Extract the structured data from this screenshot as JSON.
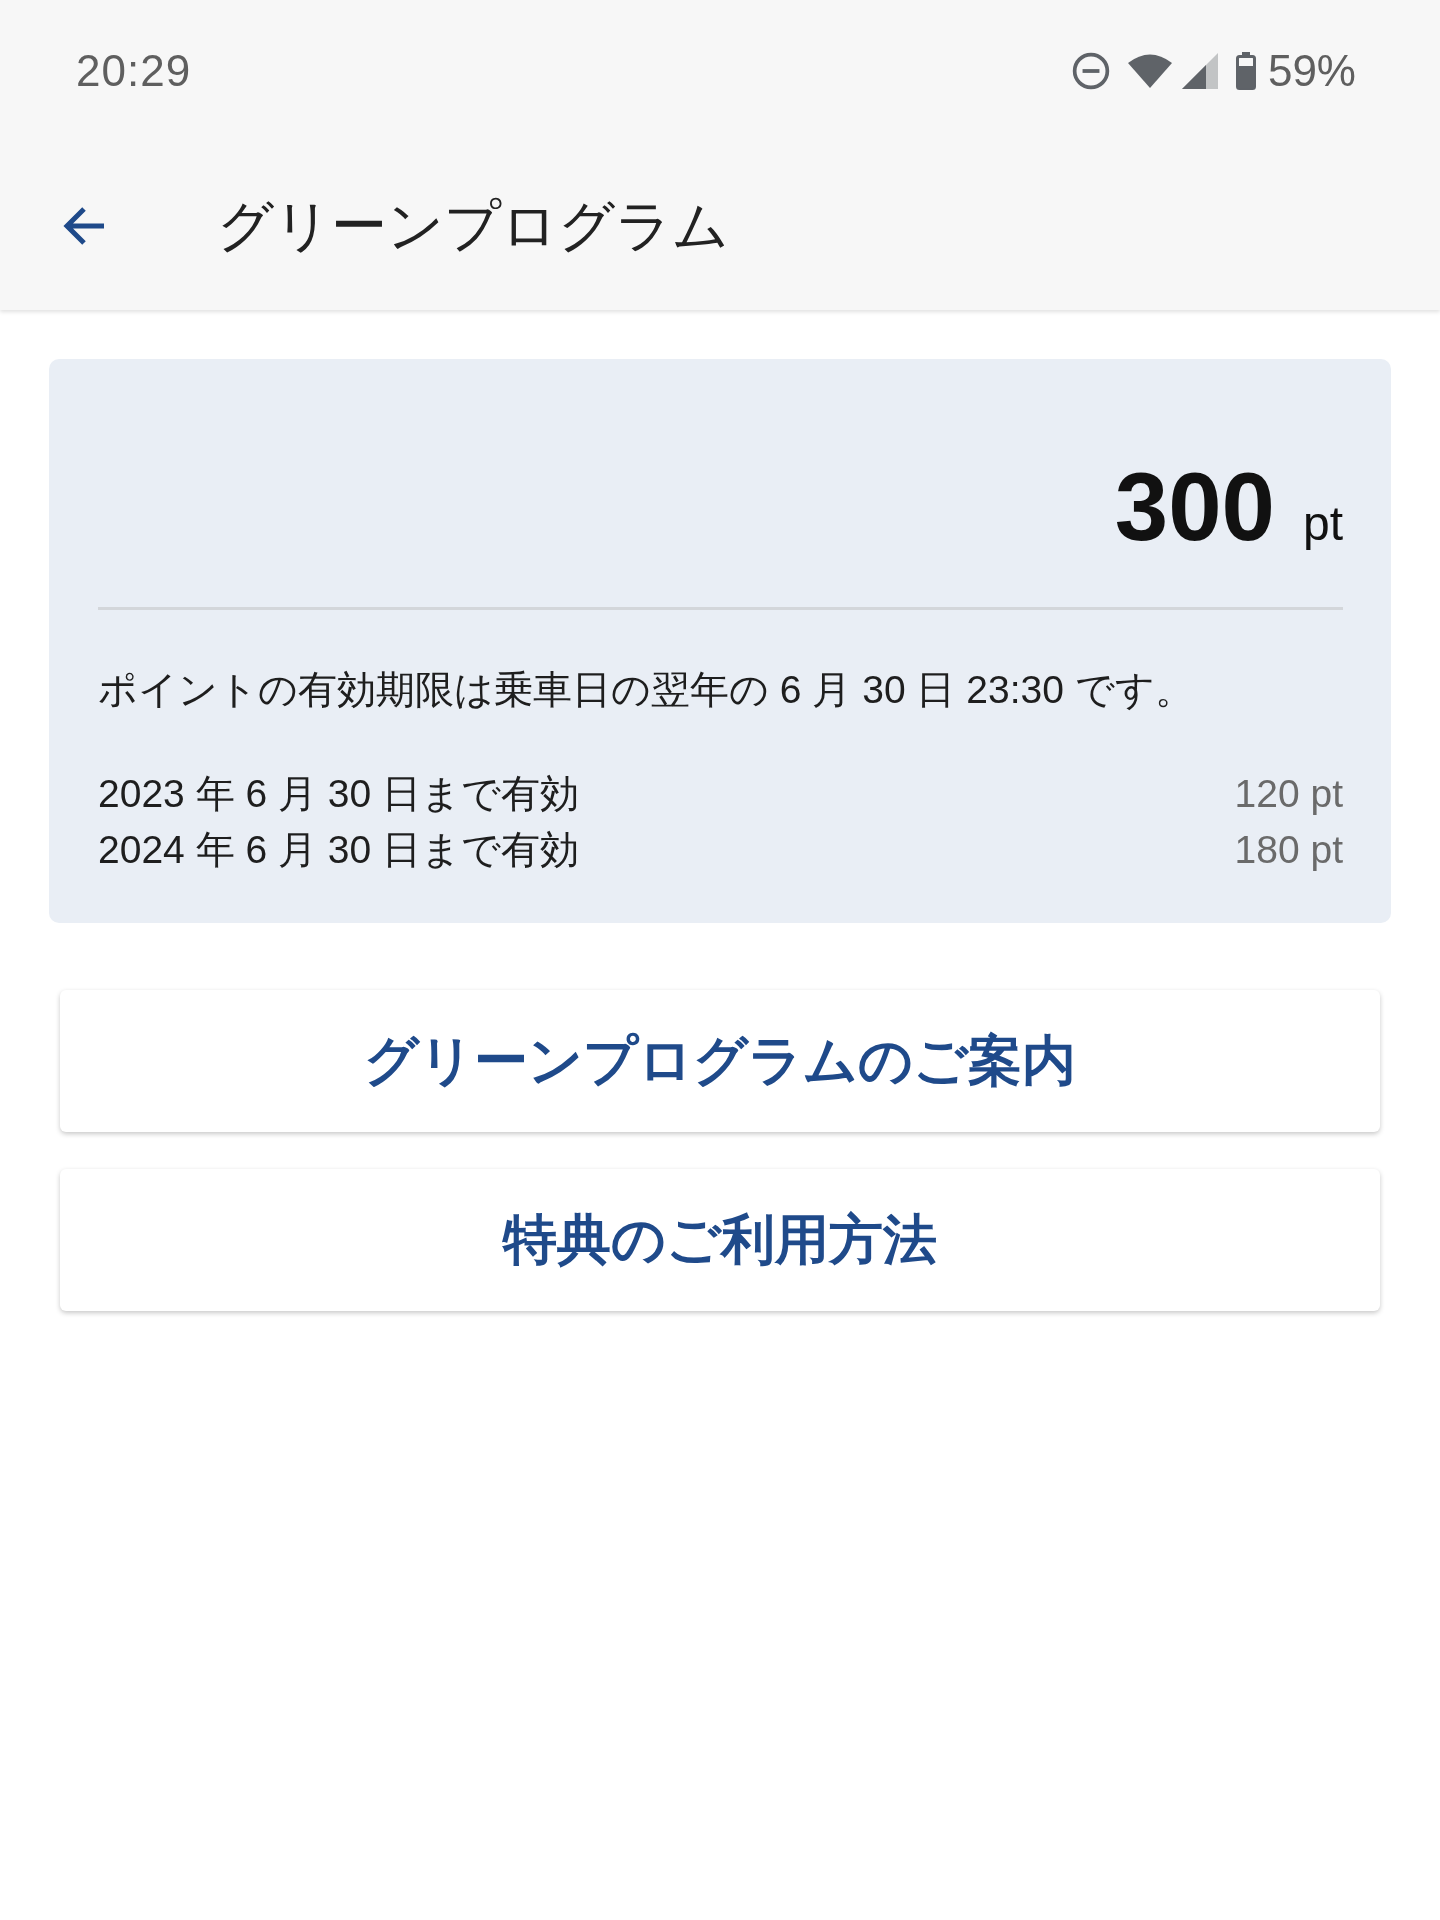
{
  "status_bar": {
    "time": "20:29",
    "battery_percent": "59%"
  },
  "app_bar": {
    "title": "グリーンプログラム"
  },
  "points_card": {
    "total": "300",
    "total_unit": "pt",
    "notice": "ポイントの有効期限は乗車日の翌年の 6 月 30 日 23:30 です。",
    "expirations": [
      {
        "label": "2023 年 6 月 30 日まで有効",
        "points": "120 pt"
      },
      {
        "label": "2024 年 6 月 30 日まで有効",
        "points": "180 pt"
      }
    ]
  },
  "buttons": [
    "グリーンプログラムのご案内",
    "特典のご利用方法"
  ]
}
